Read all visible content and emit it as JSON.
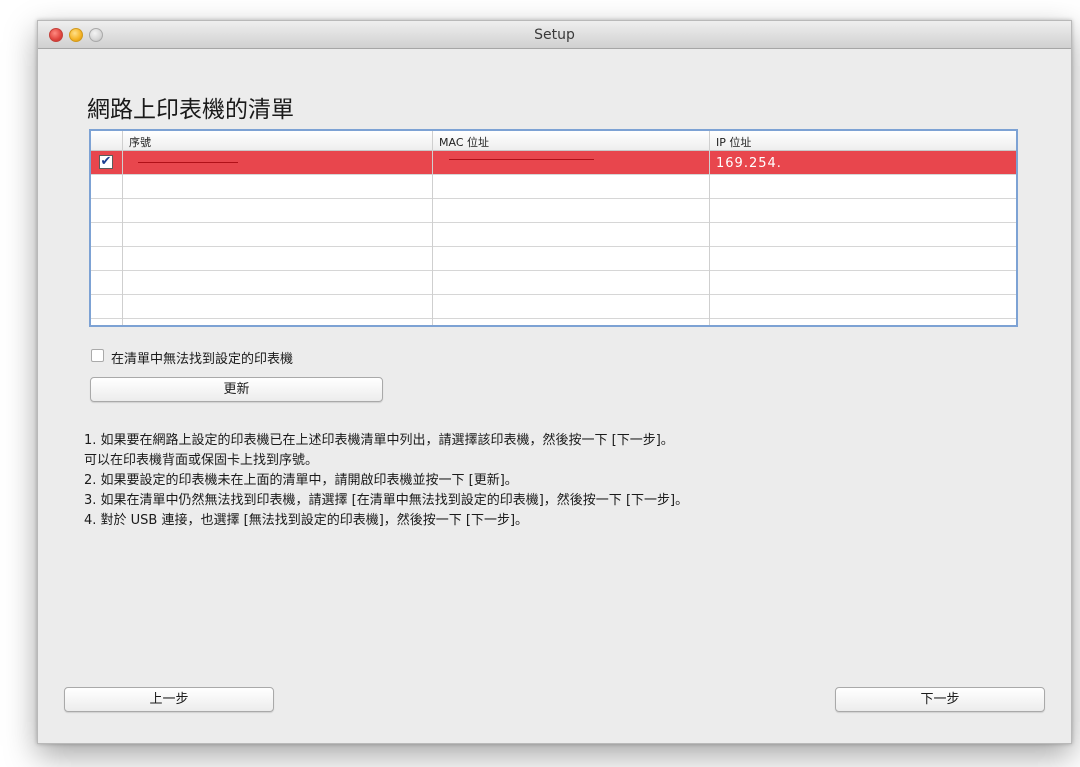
{
  "window": {
    "title": "Setup"
  },
  "heading": "網路上印表機的清單",
  "table": {
    "columns": [
      "序號",
      "MAC 位址",
      "IP 位址"
    ],
    "rows": [
      {
        "checked": true,
        "serial": "",
        "mac": "",
        "ip": "169.254.",
        "selected": true
      },
      {
        "checked": false,
        "serial": "",
        "mac": "",
        "ip": ""
      },
      {
        "checked": false,
        "serial": "",
        "mac": "",
        "ip": ""
      },
      {
        "checked": false,
        "serial": "",
        "mac": "",
        "ip": ""
      },
      {
        "checked": false,
        "serial": "",
        "mac": "",
        "ip": ""
      },
      {
        "checked": false,
        "serial": "",
        "mac": "",
        "ip": ""
      },
      {
        "checked": false,
        "serial": "",
        "mac": "",
        "ip": ""
      }
    ],
    "selected_row_color": "#e8464d"
  },
  "not_found_checkbox": {
    "label": "在清單中無法找到設定的印表機",
    "checked": false
  },
  "refresh_button": "更新",
  "instructions": [
    "1. 如果要在網路上設定的印表機已在上述印表機清單中列出，請選擇該印表機，然後按一下 [下一步]。",
    "可以在印表機背面或保固卡上找到序號。",
    "2. 如果要設定的印表機未在上面的清單中，請開啟印表機並按一下 [更新]。",
    "3. 如果在清單中仍然無法找到印表機，請選擇 [在清單中無法找到設定的印表機]，然後按一下 [下一步]。",
    "4. 對於 USB 連接，也選擇 [無法找到設定的印表機]，然後按一下 [下一步]。"
  ],
  "back_button": "上一步",
  "next_button": "下一步"
}
